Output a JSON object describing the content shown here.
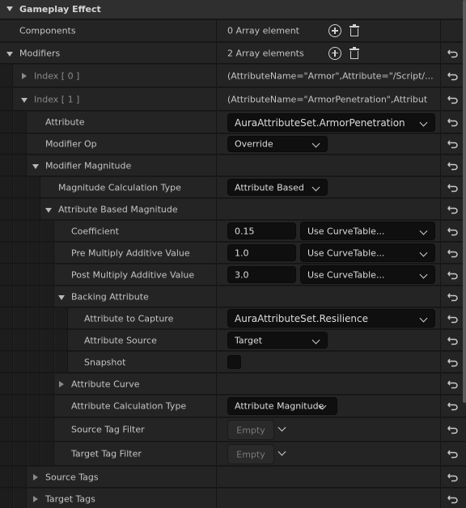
{
  "section": {
    "title": "Gameplay Effect"
  },
  "components": {
    "label": "Components",
    "value": "0 Array element"
  },
  "modifiers": {
    "label": "Modifiers",
    "value": "2 Array elements"
  },
  "index0": {
    "label": "Index [ 0 ]",
    "value": "(AttributeName=\"Armor\",Attribute=\"/Script/..."
  },
  "index1": {
    "label": "Index [ 1 ]",
    "value": "(AttributeName=\"ArmorPenetration\",Attribut"
  },
  "attribute": {
    "label": "Attribute",
    "value": "AuraAttributeSet.ArmorPenetration"
  },
  "modifier_op": {
    "label": "Modifier Op",
    "value": "Override"
  },
  "modifier_magnitude": {
    "label": "Modifier Magnitude"
  },
  "magnitude_calc_type": {
    "label": "Magnitude Calculation Type",
    "value": "Attribute Based"
  },
  "attribute_based_magnitude": {
    "label": "Attribute Based Magnitude"
  },
  "coefficient": {
    "label": "Coefficient",
    "value": "0.15",
    "curve": "Use CurveTable..."
  },
  "pre_multiply": {
    "label": "Pre Multiply Additive Value",
    "value": "1.0",
    "curve": "Use CurveTable..."
  },
  "post_multiply": {
    "label": "Post Multiply Additive Value",
    "value": "3.0",
    "curve": "Use CurveTable..."
  },
  "backing_attribute": {
    "label": "Backing Attribute"
  },
  "attribute_to_capture": {
    "label": "Attribute to Capture",
    "value": "AuraAttributeSet.Resilience"
  },
  "attribute_source": {
    "label": "Attribute Source",
    "value": "Target"
  },
  "snapshot": {
    "label": "Snapshot",
    "checked": false
  },
  "attribute_curve": {
    "label": "Attribute Curve"
  },
  "attribute_calc_type": {
    "label": "Attribute Calculation Type",
    "value": "Attribute Magnitude"
  },
  "source_tag_filter": {
    "label": "Source Tag Filter",
    "value": "Empty"
  },
  "target_tag_filter": {
    "label": "Target Tag Filter",
    "value": "Empty"
  },
  "source_tags": {
    "label": "Source Tags"
  },
  "target_tags": {
    "label": "Target Tags"
  },
  "icons": {
    "expand": "triangle-down",
    "collapse": "triangle-right",
    "add": "plus-circle",
    "delete": "trash",
    "reset": "reset-arrow",
    "dropdown": "chevron-down"
  }
}
